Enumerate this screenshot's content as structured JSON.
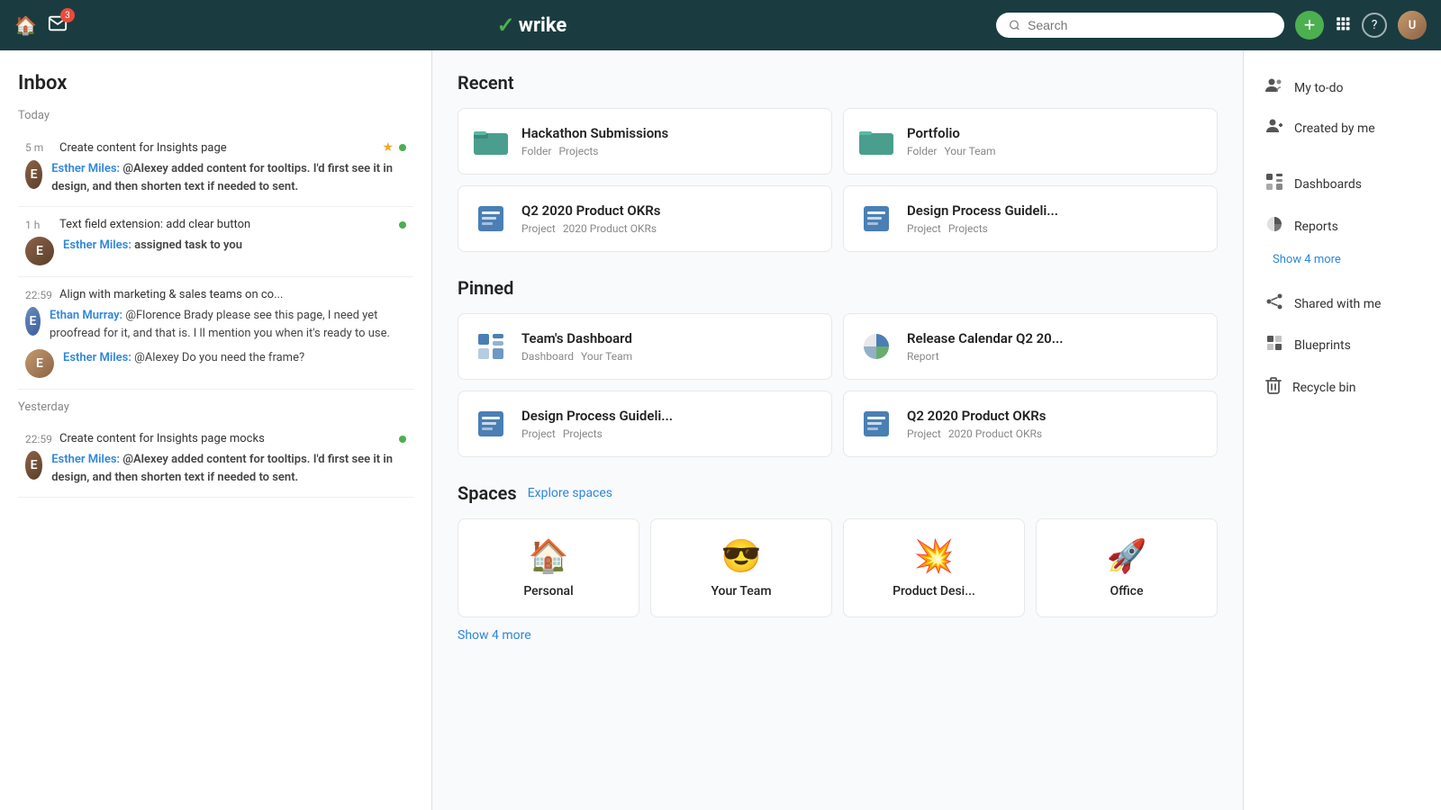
{
  "header": {
    "inbox_badge": "3",
    "logo_text": "wrike",
    "search_placeholder": "Search",
    "add_btn_label": "+",
    "help_label": "?"
  },
  "inbox": {
    "title": "Inbox",
    "date_today": "Today",
    "date_yesterday": "Yesterday",
    "items": [
      {
        "time": "5 m",
        "subject": "Create content for Insights page",
        "starred": true,
        "unread": true,
        "username": "Esther Miles:",
        "message": "@Alexey added content for tooltips. I'd first see it in design, and then shorten text if needed to sent.",
        "avatar_initial": "E"
      },
      {
        "time": "1 h",
        "subject": "Text field extension: add clear button",
        "starred": false,
        "unread": true,
        "username": "Esther Miles:",
        "message": "assigned task to you",
        "avatar_initial": "E"
      },
      {
        "time": "22:59",
        "subject": "Align with marketing & sales teams on co...",
        "starred": false,
        "unread": false,
        "username1": "Ethan Murray:",
        "message1": "@Florence Brady please see this page, I need yet proofread for it, and that is. I ll mention you when it's ready to use.",
        "username2": "Esther Miles:",
        "message2": "@Alexey Do you need the frame?",
        "avatar_initial1": "E",
        "avatar_initial2": "E"
      },
      {
        "time": "22:59",
        "subject": "Create content for Insights page mocks",
        "starred": false,
        "unread": true,
        "username": "Esther Miles:",
        "message": "@Alexey added content for tooltips. I'd first see it in design, and then shorten text if needed to sent.",
        "avatar_initial": "E"
      }
    ]
  },
  "recent": {
    "title": "Recent",
    "items": [
      {
        "name": "Hackathon Submissions",
        "type": "Folder",
        "parent": "Projects",
        "icon": "folder"
      },
      {
        "name": "Portfolio",
        "type": "Folder",
        "parent": "Your Team",
        "icon": "folder"
      },
      {
        "name": "Q2 2020 Product OKRs",
        "type": "Project",
        "parent": "2020 Product OKRs",
        "icon": "project"
      },
      {
        "name": "Design Process Guideli...",
        "type": "Project",
        "parent": "Projects",
        "icon": "project"
      }
    ]
  },
  "pinned": {
    "title": "Pinned",
    "items": [
      {
        "name": "Team's Dashboard",
        "type": "Dashboard",
        "parent": "Your Team",
        "icon": "dashboard"
      },
      {
        "name": "Release Calendar Q2 20...",
        "type": "Report",
        "parent": "",
        "icon": "report"
      },
      {
        "name": "Design Process Guideli...",
        "type": "Project",
        "parent": "Projects",
        "icon": "project"
      },
      {
        "name": "Q2 2020 Product OKRs",
        "type": "Project",
        "parent": "2020 Product OKRs",
        "icon": "project"
      }
    ]
  },
  "spaces": {
    "title": "Spaces",
    "explore_label": "Explore spaces",
    "show_more_label": "Show 4 more",
    "items": [
      {
        "name": "Personal",
        "emoji": "🏠"
      },
      {
        "name": "Your Team",
        "emoji": "😎"
      },
      {
        "name": "Product Desi...",
        "emoji": "💥"
      },
      {
        "name": "Office",
        "emoji": "🚀"
      }
    ]
  },
  "right_sidebar": {
    "items": [
      {
        "label": "My to-do",
        "icon": "people-icon"
      },
      {
        "label": "Created by me",
        "icon": "person-add-icon"
      },
      {
        "label": "Dashboards",
        "icon": "dashboard-icon"
      },
      {
        "label": "Reports",
        "icon": "pie-chart-icon"
      },
      {
        "show_more": "Show 4 more"
      },
      {
        "label": "Shared with me",
        "icon": "share-icon"
      },
      {
        "label": "Blueprints",
        "icon": "blueprint-icon"
      },
      {
        "label": "Recycle bin",
        "icon": "trash-icon"
      }
    ]
  }
}
